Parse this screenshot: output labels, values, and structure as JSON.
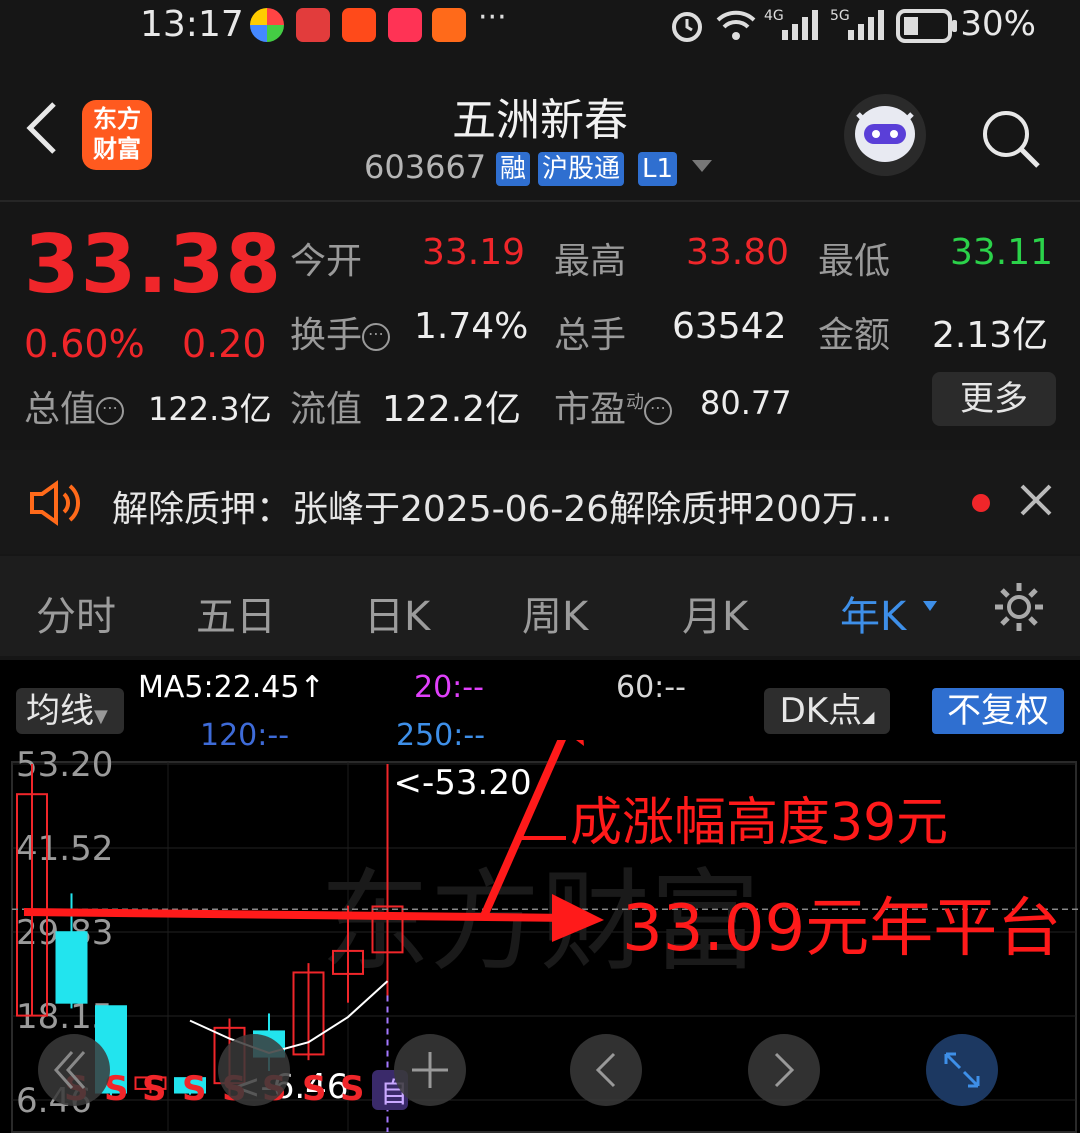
{
  "status_bar": {
    "time": "13:17",
    "more": "···",
    "net1": "4G",
    "net2": "5G",
    "battery": "30%",
    "icons": [
      "photos-app-icon",
      "huawei-app-icon",
      "video-app-icon",
      "red-app-icon",
      "orange-app-icon",
      "alarm-icon",
      "wifi-icon",
      "signal-icon",
      "battery-icon"
    ]
  },
  "header": {
    "logo_line1": "东方",
    "logo_line2": "财富",
    "title": "五洲新春",
    "code": "603667",
    "tags": [
      "融",
      "沪股通",
      "L1"
    ]
  },
  "quote": {
    "price": "33.38",
    "change_pct": "0.60%",
    "change": "0.20",
    "open_label": "今开",
    "open": "33.19",
    "high_label": "最高",
    "high": "33.80",
    "low_label": "最低",
    "low": "33.11",
    "turnover_label": "换手",
    "turnover": "1.74%",
    "volume_label": "总手",
    "volume": "63542",
    "amount_label": "金额",
    "amount": "2.13亿",
    "mktcap_label": "总值",
    "mktcap": "122.3亿",
    "float_label": "流值",
    "float": "122.2亿",
    "pe_label": "市盈",
    "pe_sup": "动",
    "pe": "80.77",
    "more_button": "更多"
  },
  "news": {
    "text": "解除质押：张峰于2025-06-26解除质押200万..."
  },
  "tabs": [
    "分时",
    "五日",
    "日K",
    "周K",
    "月K",
    "年K"
  ],
  "active_tab": "年K",
  "chart": {
    "ma_mode": "均线",
    "ma5": "MA5:22.45↑",
    "ma20": "20:--",
    "ma60": "60:--",
    "ma120": "120:--",
    "ma250": "250:--",
    "dk_button": "DK点",
    "adjust_button": "不复权",
    "max_label": "<-53.20",
    "min_label": "<-6.46",
    "colors": {
      "up": "#f0262a",
      "down": "#22e4ee",
      "ma5": "#ffffff",
      "ma20": "#e040fb",
      "ma120": "#3e6bd8",
      "ma250": "#3e8fe8"
    }
  },
  "annotations": {
    "rise": "成涨幅高度39元",
    "platform": "33.09元年平台"
  },
  "watermark": "东方财富",
  "chart_data": {
    "type": "candlestick",
    "y_ticks": [
      "53.20",
      "41.52",
      "29.83",
      "18.15",
      "6.46"
    ],
    "ylim": [
      6.46,
      53.2
    ],
    "candles": [
      {
        "open": 18.2,
        "close": 49.0,
        "high": 53.2,
        "low": 18.2,
        "dir": "up"
      },
      {
        "open": 29.8,
        "close": 20.0,
        "high": 35.2,
        "low": 19.2,
        "dir": "down"
      },
      {
        "open": 19.5,
        "close": 7.5,
        "high": 19.5,
        "low": 6.8,
        "dir": "down"
      },
      {
        "open": 8.0,
        "close": 9.6,
        "high": 9.8,
        "low": 7.4,
        "dir": "up"
      },
      {
        "open": 9.5,
        "close": 7.5,
        "high": 9.8,
        "low": 7.2,
        "dir": "down"
      },
      {
        "open": 8.8,
        "close": 16.5,
        "high": 17.8,
        "low": 6.5,
        "dir": "up"
      },
      {
        "open": 16.0,
        "close": 12.5,
        "high": 18.5,
        "low": 10.5,
        "dir": "down"
      },
      {
        "open": 12.8,
        "close": 24.2,
        "high": 25.5,
        "low": 12.0,
        "dir": "up"
      },
      {
        "open": 24.0,
        "close": 27.2,
        "high": 33.5,
        "low": 20.0,
        "dir": "up"
      },
      {
        "open": 27.0,
        "close": 33.38,
        "high": 53.2,
        "low": 21.0,
        "dir": "up"
      }
    ],
    "ma5": [
      null,
      null,
      null,
      null,
      17.5,
      15.0,
      13.0,
      14.5,
      18.0,
      23.0
    ]
  }
}
